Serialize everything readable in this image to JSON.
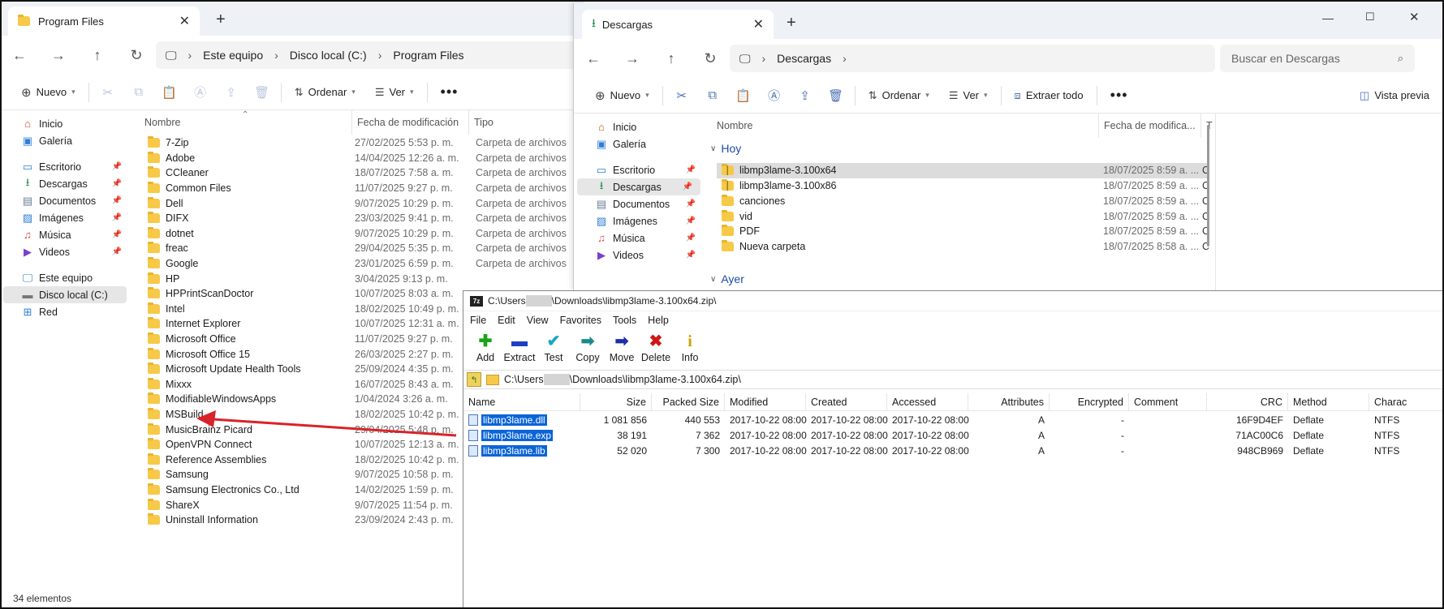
{
  "left_window": {
    "tab_title": "Program Files",
    "breadcrumb": [
      "Este equipo",
      "Disco local (C:)",
      "Program Files"
    ],
    "commands": {
      "new": "Nuevo",
      "sort": "Ordenar",
      "view": "Ver"
    },
    "sidebar": [
      {
        "label": "Inicio",
        "icon": "home-icon",
        "pinned": false
      },
      {
        "label": "Galería",
        "icon": "gallery-icon",
        "pinned": false
      },
      {
        "label": "Escritorio",
        "icon": "desktop-icon",
        "pinned": true
      },
      {
        "label": "Descargas",
        "icon": "download-icon",
        "pinned": true
      },
      {
        "label": "Documentos",
        "icon": "documents-icon",
        "pinned": true
      },
      {
        "label": "Imágenes",
        "icon": "pictures-icon",
        "pinned": true
      },
      {
        "label": "Música",
        "icon": "music-icon",
        "pinned": true
      },
      {
        "label": "Videos",
        "icon": "videos-icon",
        "pinned": true
      },
      {
        "label": "Este equipo",
        "icon": "computer-icon",
        "pinned": false
      },
      {
        "label": "Disco local (C:)",
        "icon": "drive-icon",
        "pinned": false
      },
      {
        "label": "Red",
        "icon": "network-icon",
        "pinned": false
      }
    ],
    "columns": {
      "name": "Nombre",
      "modified": "Fecha de modificación",
      "type": "Tipo"
    },
    "files": [
      {
        "name": "7-Zip",
        "modified": "27/02/2025 5:53 p. m.",
        "type": "Carpeta de archivos"
      },
      {
        "name": "Adobe",
        "modified": "14/04/2025 12:26 a. m.",
        "type": "Carpeta de archivos"
      },
      {
        "name": "CCleaner",
        "modified": "18/07/2025 7:58 a. m.",
        "type": "Carpeta de archivos"
      },
      {
        "name": "Common Files",
        "modified": "11/07/2025 9:27 p. m.",
        "type": "Carpeta de archivos"
      },
      {
        "name": "Dell",
        "modified": "9/07/2025 10:29 p. m.",
        "type": "Carpeta de archivos"
      },
      {
        "name": "DIFX",
        "modified": "23/03/2025 9:41 p. m.",
        "type": "Carpeta de archivos"
      },
      {
        "name": "dotnet",
        "modified": "9/07/2025 10:29 p. m.",
        "type": "Carpeta de archivos"
      },
      {
        "name": "freac",
        "modified": "29/04/2025 5:35 p. m.",
        "type": "Carpeta de archivos"
      },
      {
        "name": "Google",
        "modified": "23/01/2025 6:59 p. m.",
        "type": "Carpeta de archivos"
      },
      {
        "name": "HP",
        "modified": "3/04/2025 9:13 p. m.",
        "type": ""
      },
      {
        "name": "HPPrintScanDoctor",
        "modified": "10/07/2025 8:03 a. m.",
        "type": ""
      },
      {
        "name": "Intel",
        "modified": "18/02/2025 10:49 p. m.",
        "type": ""
      },
      {
        "name": "Internet Explorer",
        "modified": "10/07/2025 12:31 a. m.",
        "type": ""
      },
      {
        "name": "Microsoft Office",
        "modified": "11/07/2025 9:27 p. m.",
        "type": ""
      },
      {
        "name": "Microsoft Office 15",
        "modified": "26/03/2025 2:27 p. m.",
        "type": ""
      },
      {
        "name": "Microsoft Update Health Tools",
        "modified": "25/09/2024 4:35 p. m.",
        "type": ""
      },
      {
        "name": "Mixxx",
        "modified": "16/07/2025 8:43 a. m.",
        "type": ""
      },
      {
        "name": "ModifiableWindowsApps",
        "modified": "1/04/2024 3:26 a. m.",
        "type": ""
      },
      {
        "name": "MSBuild",
        "modified": "18/02/2025 10:42 p. m.",
        "type": ""
      },
      {
        "name": "MusicBrainz Picard",
        "modified": "29/04/2025 5:48 p. m.",
        "type": ""
      },
      {
        "name": "OpenVPN Connect",
        "modified": "10/07/2025 12:13 a. m.",
        "type": ""
      },
      {
        "name": "Reference Assemblies",
        "modified": "18/02/2025 10:42 p. m.",
        "type": ""
      },
      {
        "name": "Samsung",
        "modified": "9/07/2025 10:58 p. m.",
        "type": ""
      },
      {
        "name": "Samsung Electronics Co., Ltd",
        "modified": "14/02/2025 1:59 p. m.",
        "type": ""
      },
      {
        "name": "ShareX",
        "modified": "9/07/2025 11:54 p. m.",
        "type": ""
      },
      {
        "name": "Uninstall Information",
        "modified": "23/09/2024 2:43 p. m.",
        "type": ""
      }
    ],
    "status": "34 elementos"
  },
  "right_window": {
    "tab_title": "Descargas",
    "breadcrumb": [
      "Descargas"
    ],
    "search_placeholder": "Buscar en Descargas",
    "commands": {
      "new": "Nuevo",
      "sort": "Ordenar",
      "view": "Ver",
      "extract": "Extraer todo",
      "preview": "Vista previa"
    },
    "sidebar": [
      {
        "label": "Inicio",
        "icon": "home-icon"
      },
      {
        "label": "Galería",
        "icon": "gallery-icon"
      },
      {
        "label": "Escritorio",
        "icon": "desktop-icon"
      },
      {
        "label": "Descargas",
        "icon": "download-icon"
      },
      {
        "label": "Documentos",
        "icon": "documents-icon"
      },
      {
        "label": "Imágenes",
        "icon": "pictures-icon"
      },
      {
        "label": "Música",
        "icon": "music-icon"
      },
      {
        "label": "Videos",
        "icon": "videos-icon"
      }
    ],
    "columns": {
      "name": "Nombre",
      "modified": "Fecha de modifica...",
      "type": "T"
    },
    "groups": {
      "today": "Hoy",
      "yesterday": "Ayer"
    },
    "files": [
      {
        "name": "libmp3lame-3.100x64",
        "modified": "18/07/2025 8:59 a. ...",
        "type": "C",
        "zip": true
      },
      {
        "name": "libmp3lame-3.100x86",
        "modified": "18/07/2025 8:59 a. ...",
        "type": "C",
        "zip": true
      },
      {
        "name": "canciones",
        "modified": "18/07/2025 8:59 a. ...",
        "type": "C",
        "zip": false
      },
      {
        "name": "vid",
        "modified": "18/07/2025 8:59 a. ...",
        "type": "C",
        "zip": false
      },
      {
        "name": "PDF",
        "modified": "18/07/2025 8:59 a. ...",
        "type": "C",
        "zip": false
      },
      {
        "name": "Nueva carpeta",
        "modified": "18/07/2025 8:58 a. ...",
        "type": "C",
        "zip": false
      }
    ]
  },
  "zip_window": {
    "title_prefix": "C:\\Users",
    "title_suffix": "\\Downloads\\libmp3lame-3.100x64.zip\\",
    "logo": "7z",
    "menu": [
      "File",
      "Edit",
      "View",
      "Favorites",
      "Tools",
      "Help"
    ],
    "toolbar": [
      {
        "label": "Add",
        "glyph": "✚",
        "color": "#1aa31a"
      },
      {
        "label": "Extract",
        "glyph": "▬",
        "color": "#1c3fc4"
      },
      {
        "label": "Test",
        "glyph": "✔",
        "color": "#19a6c2"
      },
      {
        "label": "Copy",
        "glyph": "➡",
        "color": "#1a8a8a"
      },
      {
        "label": "Move",
        "glyph": "➡",
        "color": "#1c2fa8"
      },
      {
        "label": "Delete",
        "glyph": "✖",
        "color": "#d01515"
      },
      {
        "label": "Info",
        "glyph": "i",
        "color": "#c9a400"
      }
    ],
    "path_prefix": "C:\\Users",
    "path_suffix": "\\Downloads\\libmp3lame-3.100x64.zip\\",
    "columns": [
      "Name",
      "Size",
      "Packed Size",
      "Modified",
      "Created",
      "Accessed",
      "Attributes",
      "Encrypted",
      "Comment",
      "CRC",
      "Method",
      "Charac"
    ],
    "rows": [
      {
        "name": "libmp3lame.dll",
        "size": "1 081 856",
        "packed": "440 553",
        "modified": "2017-10-22 08:00",
        "created": "2017-10-22 08:00",
        "accessed": "2017-10-22 08:00",
        "attr": "A",
        "enc": "-",
        "comment": "",
        "crc": "16F9D4EF",
        "method": "Deflate",
        "charac": "NTFS"
      },
      {
        "name": "libmp3lame.exp",
        "size": "38 191",
        "packed": "7 362",
        "modified": "2017-10-22 08:00",
        "created": "2017-10-22 08:00",
        "accessed": "2017-10-22 08:00",
        "attr": "A",
        "enc": "-",
        "comment": "",
        "crc": "71AC00C6",
        "method": "Deflate",
        "charac": "NTFS"
      },
      {
        "name": "libmp3lame.lib",
        "size": "52 020",
        "packed": "7 300",
        "modified": "2017-10-22 08:00",
        "created": "2017-10-22 08:00",
        "accessed": "2017-10-22 08:00",
        "attr": "A",
        "enc": "-",
        "comment": "",
        "crc": "948CB969",
        "method": "Deflate",
        "charac": "NTFS"
      }
    ]
  },
  "colors": {
    "accent": "#0a64d8",
    "arrow": "#d8232a",
    "folder": "#f7c948",
    "selection": "#dcdcdc"
  }
}
